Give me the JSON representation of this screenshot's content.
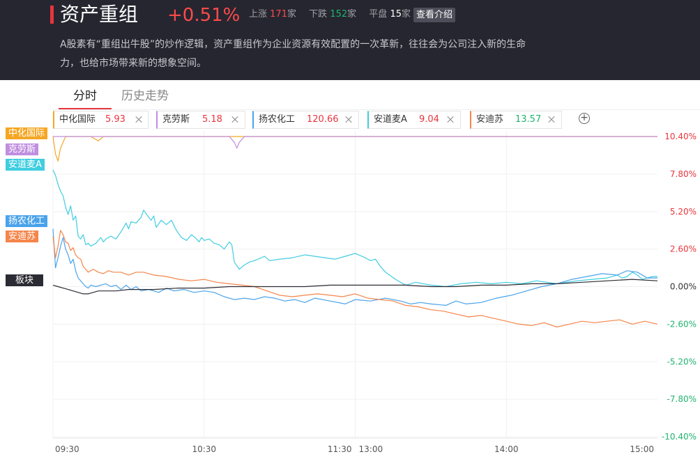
{
  "header": {
    "title": "资产重组",
    "change": "+0.51%",
    "up_label": "上涨",
    "up_count": "171",
    "up_unit": "家",
    "down_label": "下跌",
    "down_count": "152",
    "down_unit": "家",
    "flat_label": "平盘",
    "flat_count": "15",
    "flat_unit": "家",
    "intro_button": "查看介绍",
    "description": "A股素有“重组出牛股”的炒作逻辑，资产重组作为企业资源有效配置的一次革新，往往会为公司注入新的生命力，也给市场带来新的想象空间。"
  },
  "tabs": [
    {
      "label": "分时",
      "active": true
    },
    {
      "label": "历史走势",
      "active": false
    }
  ],
  "stocks": [
    {
      "name": "中化国际",
      "price": "5.93",
      "color": "#f5a623",
      "price_color": "#e8353d"
    },
    {
      "name": "克劳斯",
      "price": "5.18",
      "color": "#c08ee0",
      "price_color": "#e8353d"
    },
    {
      "name": "扬农化工",
      "price": "120.66",
      "color": "#4aa3ea",
      "price_color": "#e8353d"
    },
    {
      "name": "安道麦A",
      "price": "9.04",
      "color": "#3fcde0",
      "price_color": "#e8353d"
    },
    {
      "name": "安迪苏",
      "price": "13.57",
      "color": "#f5854a",
      "price_color": "#1fb36e"
    }
  ],
  "add_icon": "plus-circle-icon",
  "side_labels": [
    {
      "text": "中化国际",
      "color": "#f5a623"
    },
    {
      "text": "克劳斯",
      "color": "#c08ee0"
    },
    {
      "text": "安道麦A",
      "color": "#3fcde0"
    },
    {
      "text": "扬农化工",
      "color": "#4aa3ea"
    },
    {
      "text": "安迪苏",
      "color": "#f5854a"
    },
    {
      "text": "板块",
      "color": "#2b2b33"
    }
  ],
  "chart_data": {
    "type": "line",
    "x_ticks": [
      "09:30",
      "10:30",
      "11:30",
      "13:00",
      "14:00",
      "15:00"
    ],
    "x_tick_minutes": [
      0,
      60,
      120,
      120,
      180,
      240
    ],
    "y_ticks": [
      "10.40%",
      "7.80%",
      "5.20%",
      "2.60%",
      "0.00%",
      "-2.60%",
      "-5.20%",
      "-7.80%",
      "-10.40%"
    ],
    "y_tick_values": [
      10.4,
      7.8,
      5.2,
      2.6,
      0,
      -2.6,
      -5.2,
      -7.8,
      -10.4
    ],
    "ylim": [
      -10.4,
      10.4
    ],
    "xlim": [
      0,
      240
    ],
    "up_color": "#e8353d",
    "down_color": "#1fb36e",
    "grid": true,
    "series": [
      {
        "name": "中化国际",
        "color": "#f5a623",
        "x": [
          0,
          1,
          2,
          3,
          5,
          8,
          15,
          18,
          20,
          30,
          60,
          120,
          180,
          240
        ],
        "y": [
          10.4,
          9.2,
          8.7,
          9.6,
          10.4,
          10.4,
          10.4,
          10.1,
          10.4,
          10.4,
          10.4,
          10.4,
          10.4,
          10.4
        ]
      },
      {
        "name": "克劳斯",
        "color": "#c08ee0",
        "x": [
          0,
          60,
          70,
          72,
          73,
          74,
          76,
          120,
          180,
          240
        ],
        "y": [
          10.4,
          10.4,
          10.4,
          10.0,
          9.6,
          10.0,
          10.4,
          10.4,
          10.4,
          10.4
        ]
      },
      {
        "name": "安道麦A",
        "color": "#3fcde0",
        "x": [
          0,
          1,
          2,
          3,
          4,
          5,
          6,
          7,
          8,
          9,
          10,
          11,
          12,
          13,
          14,
          15,
          17,
          19,
          20,
          21,
          23,
          25,
          27,
          29,
          30,
          31,
          33,
          35,
          36,
          38,
          39,
          40,
          41,
          43,
          45,
          47,
          49,
          51,
          53,
          55,
          57,
          58,
          59,
          60,
          62,
          64,
          66,
          68,
          70,
          71,
          72,
          74,
          76,
          78,
          80,
          84,
          86,
          90,
          95,
          100,
          104,
          108,
          112,
          116,
          120,
          124,
          126,
          128,
          130,
          132,
          136,
          140,
          144,
          150,
          156,
          162,
          168,
          174,
          180,
          186,
          192,
          200,
          208,
          214,
          220,
          224,
          226,
          228,
          230,
          232,
          234,
          236,
          238,
          240
        ],
        "y": [
          8.1,
          7.7,
          7.1,
          6.6,
          6.3,
          5.5,
          5.0,
          5.6,
          4.6,
          4.9,
          3.5,
          3.3,
          3.6,
          2.9,
          3.0,
          2.8,
          3.0,
          3.4,
          3.1,
          3.3,
          3.5,
          3.3,
          3.8,
          4.4,
          4.0,
          4.5,
          4.4,
          4.8,
          5.3,
          4.8,
          4.6,
          4.9,
          4.1,
          4.6,
          4.3,
          4.6,
          3.9,
          3.4,
          3.2,
          3.6,
          3.3,
          3.1,
          3.4,
          3.2,
          3.3,
          3.0,
          2.9,
          2.6,
          3.1,
          2.9,
          1.7,
          1.2,
          1.5,
          1.7,
          1.8,
          2.1,
          1.8,
          1.9,
          2.0,
          2.2,
          2.1,
          2.0,
          1.9,
          2.1,
          2.3,
          2.0,
          1.8,
          1.9,
          1.4,
          1.0,
          0.5,
          0.1,
          0.3,
          0.1,
          0.0,
          0.2,
          0.3,
          0.2,
          0.3,
          0.2,
          0.4,
          0.2,
          0.4,
          0.5,
          0.6,
          0.8,
          0.6,
          0.7,
          1.0,
          0.8,
          0.5,
          0.6,
          0.7,
          0.7
        ]
      },
      {
        "name": "扬农化工",
        "color": "#4aa3ea",
        "x": [
          0,
          1,
          2,
          3,
          4,
          5,
          6,
          7,
          8,
          9,
          10,
          11,
          12,
          13,
          14,
          15,
          17,
          19,
          21,
          23,
          25,
          27,
          29,
          31,
          33,
          35,
          38,
          40,
          42,
          45,
          48,
          52,
          56,
          60,
          64,
          68,
          72,
          76,
          80,
          84,
          88,
          92,
          96,
          100,
          104,
          110,
          116,
          120,
          126,
          132,
          138,
          142,
          146,
          150,
          156,
          160,
          164,
          170,
          176,
          182,
          188,
          194,
          200,
          206,
          212,
          218,
          224,
          228,
          232,
          236,
          240
        ],
        "y": [
          4.0,
          1.3,
          2.0,
          2.8,
          3.4,
          2.6,
          2.2,
          1.6,
          1.9,
          1.1,
          0.6,
          0.4,
          0.2,
          0.0,
          -0.1,
          0.1,
          0.0,
          0.1,
          0.2,
          0.0,
          0.1,
          -0.2,
          0.1,
          -0.2,
          0.0,
          -0.3,
          -0.2,
          -0.3,
          -0.4,
          -0.1,
          -0.3,
          -0.2,
          -0.4,
          -0.3,
          -0.4,
          -0.7,
          -0.9,
          -0.8,
          -0.9,
          -0.7,
          -0.8,
          -1.0,
          -0.9,
          -1.1,
          -0.8,
          -1.0,
          -1.2,
          -0.9,
          -1.0,
          -0.8,
          -1.0,
          -1.2,
          -1.1,
          -1.2,
          -1.3,
          -1.0,
          -1.2,
          -1.1,
          -0.8,
          -0.6,
          -0.3,
          0.0,
          0.2,
          0.5,
          0.7,
          0.9,
          0.8,
          1.1,
          1.0,
          0.6,
          0.6
        ]
      },
      {
        "name": "安迪苏",
        "color": "#f5854a",
        "x": [
          0,
          1,
          2,
          3,
          4,
          5,
          6,
          7,
          8,
          9,
          10,
          11,
          12,
          14,
          16,
          18,
          20,
          22,
          24,
          27,
          30,
          33,
          36,
          40,
          45,
          50,
          55,
          60,
          65,
          70,
          75,
          80,
          85,
          90,
          95,
          100,
          105,
          110,
          115,
          120,
          125,
          130,
          135,
          140,
          145,
          150,
          155,
          160,
          165,
          170,
          175,
          180,
          185,
          190,
          195,
          200,
          205,
          210,
          215,
          220,
          225,
          230,
          235,
          240
        ],
        "y": [
          3.5,
          2.0,
          2.8,
          3.9,
          3.6,
          3.1,
          3.0,
          2.5,
          2.7,
          2.2,
          2.0,
          1.9,
          1.4,
          1.0,
          1.2,
          1.0,
          0.9,
          1.1,
          1.0,
          1.0,
          0.8,
          1.0,
          1.0,
          0.8,
          0.7,
          0.5,
          0.4,
          0.5,
          0.3,
          0.2,
          0.1,
          0.0,
          -0.3,
          -0.6,
          -0.7,
          -0.6,
          -0.5,
          -0.6,
          -0.7,
          -0.5,
          -0.8,
          -0.9,
          -1.0,
          -1.3,
          -1.4,
          -1.6,
          -1.7,
          -1.9,
          -2.1,
          -2.0,
          -2.2,
          -2.4,
          -2.6,
          -2.7,
          -2.5,
          -2.8,
          -2.6,
          -2.4,
          -2.5,
          -2.4,
          -2.3,
          -2.6,
          -2.4,
          -2.6
        ]
      },
      {
        "name": "板块",
        "color": "#2b2b33",
        "x": [
          0,
          2,
          4,
          6,
          8,
          10,
          12,
          14,
          16,
          18,
          20,
          25,
          30,
          40,
          50,
          60,
          70,
          80,
          90,
          100,
          110,
          120,
          130,
          140,
          150,
          160,
          170,
          180,
          190,
          200,
          210,
          220,
          230,
          240
        ],
        "y": [
          0.1,
          0.0,
          -0.1,
          -0.2,
          -0.3,
          -0.4,
          -0.5,
          -0.5,
          -0.4,
          -0.3,
          -0.3,
          -0.3,
          -0.2,
          -0.2,
          -0.1,
          -0.1,
          0.0,
          0.0,
          0.0,
          0.0,
          0.1,
          0.1,
          0.1,
          0.1,
          0.0,
          0.0,
          0.1,
          0.1,
          0.2,
          0.2,
          0.3,
          0.4,
          0.5,
          0.4
        ]
      }
    ]
  }
}
